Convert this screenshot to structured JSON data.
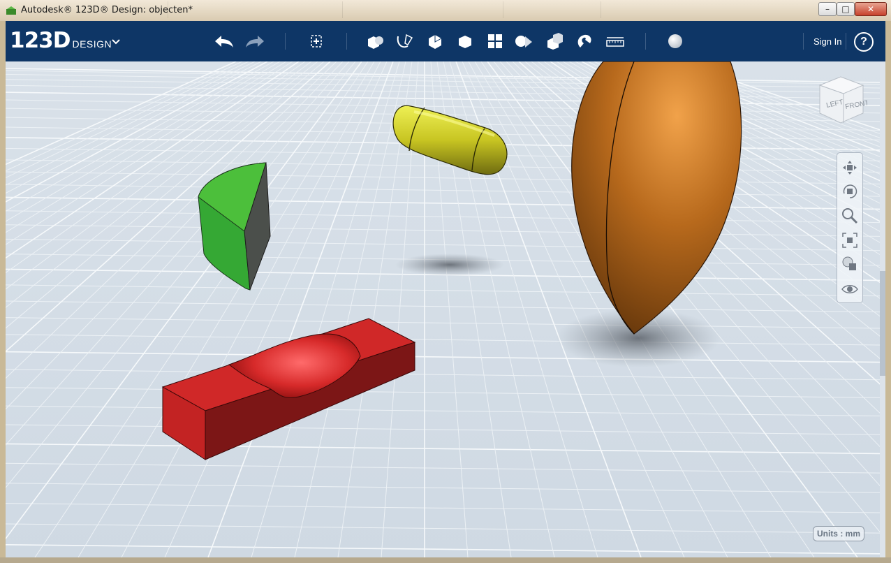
{
  "window": {
    "title": "Autodesk® 123D® Design: objecten*",
    "controls": [
      "minimize",
      "maximize",
      "close"
    ]
  },
  "app": {
    "logo_main": "123D",
    "logo_sub": "DESIGN"
  },
  "toolbar": {
    "tools": [
      {
        "name": "undo-icon"
      },
      {
        "name": "redo-icon"
      },
      {
        "name": "transform-icon"
      },
      {
        "name": "primitives-icon"
      },
      {
        "name": "sketch-icon"
      },
      {
        "name": "construct-icon"
      },
      {
        "name": "modify-icon"
      },
      {
        "name": "pattern-icon"
      },
      {
        "name": "grouping-icon"
      },
      {
        "name": "combine-icon"
      },
      {
        "name": "snap-icon"
      },
      {
        "name": "measure-icon"
      },
      {
        "name": "material-icon"
      }
    ],
    "sign_in": "Sign In",
    "help": "?"
  },
  "viewcube": {
    "left_label": "LEFT",
    "front_label": "FRONT"
  },
  "navbar": {
    "items": [
      "pan-icon",
      "orbit-icon",
      "zoom-icon",
      "fit-icon",
      "materials-visibility-icon",
      "visibility-icon"
    ]
  },
  "status": {
    "units": "Units : mm"
  },
  "scene": {
    "objects": [
      {
        "name": "wedge",
        "color": "#2f9d2c"
      },
      {
        "name": "capsule",
        "color": "#c4c220"
      },
      {
        "name": "ellipsoid",
        "color": "#b0681c"
      },
      {
        "name": "block-with-groove",
        "color": "#c8201f"
      }
    ]
  }
}
